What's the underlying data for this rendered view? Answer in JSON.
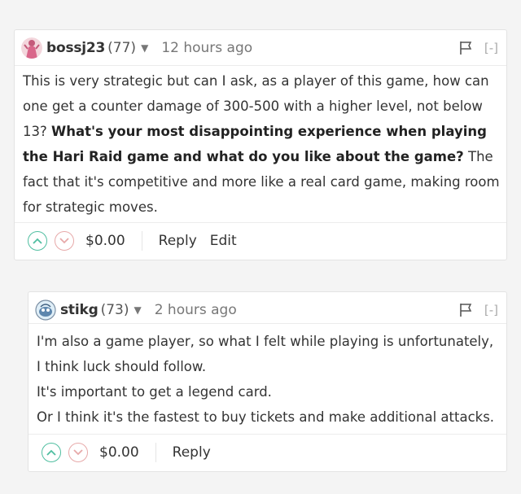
{
  "comments": [
    {
      "username": "bossj23",
      "reputation": "(77)",
      "time": "12 hours ago",
      "collapse": "[-]",
      "paragraphs": [
        [
          {
            "text": "This is very strategic but can I ask, as a player of this game, how can one get a counter damage of 300-500 with a higher level, not below 13? ",
            "bold": false
          },
          {
            "text": "What's your most disappointing experience when playing the Hari Raid game and what do you like about the game?",
            "bold": true
          },
          {
            "text": " The fact that it's competitive and more like a real card game, making room for strategic moves.",
            "bold": false
          }
        ]
      ],
      "payout": "$0.00",
      "actions": [
        "Reply",
        "Edit"
      ]
    },
    {
      "username": "stikg",
      "reputation": "(73)",
      "time": "2 hours ago",
      "collapse": "[-]",
      "paragraphs": [
        [
          {
            "text": "I'm also a game player, so what I felt while playing is unfortunately, I think luck should follow.",
            "bold": false
          }
        ],
        [
          {
            "text": "It's important to get a legend card.",
            "bold": false
          }
        ],
        [
          {
            "text": "Or I think it's the fastest to buy tickets and make additional attacks.",
            "bold": false
          }
        ]
      ],
      "payout": "$0.00",
      "actions": [
        "Reply"
      ]
    }
  ],
  "icons": {
    "upvote": "chevron-up-icon",
    "downvote": "chevron-down-icon",
    "flag": "flag-icon",
    "dropdown": "caret-down-icon"
  },
  "colors": {
    "upvote": "#4fbea0",
    "downvote": "#e7a9a9",
    "muted": "#777777"
  }
}
